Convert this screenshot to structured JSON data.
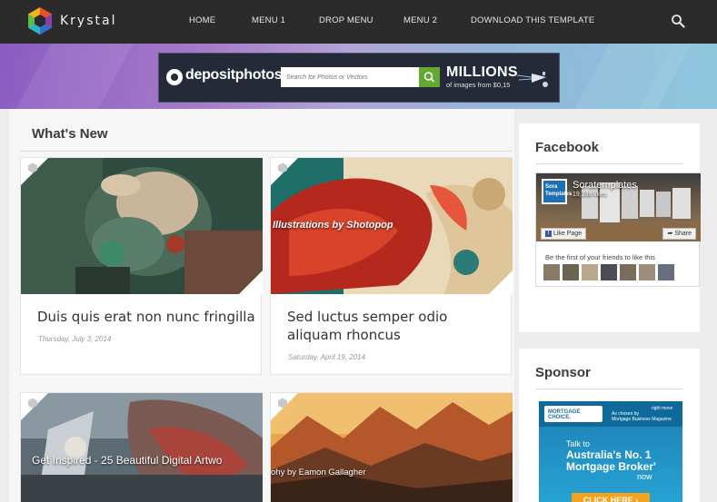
{
  "nav": {
    "brand": "Krystal",
    "menu": [
      "HOME",
      "MENU 1",
      "DROP MENU",
      "MENU 2",
      "DOWNLOAD THIS TEMPLATE"
    ],
    "search_icon": "search-icon"
  },
  "banner": {
    "brand": "depositphotos",
    "search_placeholder": "Search for Photos or Vectors",
    "headline": "MILLIONS",
    "subline": "of images from $0,15"
  },
  "main": {
    "section_title": "What's New",
    "posts": [
      {
        "title": "Duis quis erat non nunc fringilla",
        "date": "Thursday, July 3, 2014",
        "overlay": ""
      },
      {
        "title": "Sed luctus semper odio aliquam rhoncus",
        "date": "Saturday, April 19, 2014",
        "overlay": "Illustrations by Shotopop"
      },
      {
        "title": "",
        "date": "",
        "overlay": "Get Inspired - 25 Beautiful Digital Artwo"
      },
      {
        "title": "",
        "date": "",
        "overlay": "ohy by Eamon Gallagher"
      }
    ]
  },
  "sidebar": {
    "facebook": {
      "title": "Facebook",
      "page_name": "Soratemplates",
      "likes": "19,338 likes",
      "like_label": "Like Page",
      "share_label": "Share",
      "friends_text": "Be the first of your friends to like this",
      "thumb_label_1": "Sora",
      "thumb_label_2": "Templates"
    },
    "sponsor": {
      "title": "Sponsor",
      "logo_text": "MORTGAGE CHOICE.",
      "top_right_1": "right move",
      "top_right_2": "As chosen by",
      "top_right_3": "Mortgage Business Magazine",
      "talk": "Talk to",
      "headline_1": "Australia's No. 1",
      "headline_2": "Mortgage Broker'",
      "now": "now",
      "cta": "CLICK HERE ›"
    }
  },
  "colors": {
    "nav_bg": "#2b2b2b",
    "page_bg": "#ececec",
    "accent_green": "#64a731",
    "sponsor_blue": "#1d7fb5",
    "cta_orange": "#f2a21b"
  }
}
